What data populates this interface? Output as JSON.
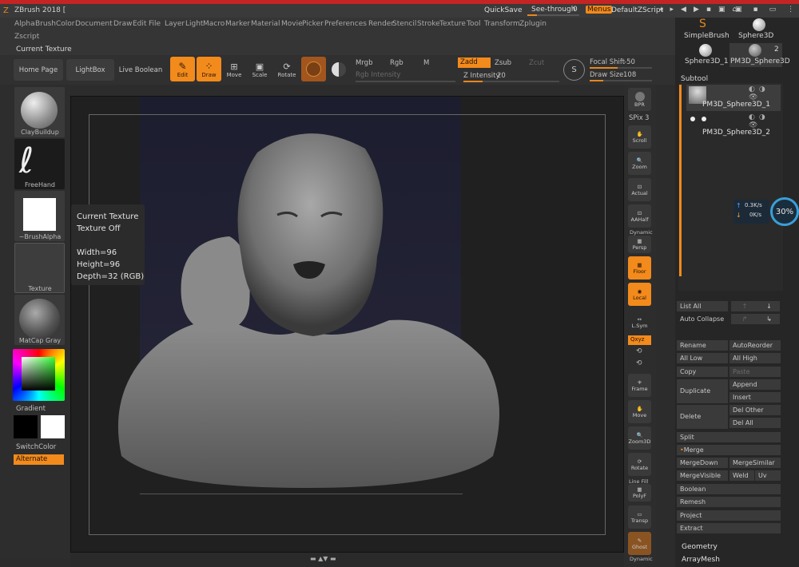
{
  "app": {
    "title": "ZBrush 2018 [",
    "quicksave": "QuickSave",
    "seethrough_label": "See-through",
    "seethrough_value": "0",
    "menus": "Menus",
    "script": "DefaultZScript"
  },
  "menu": [
    "Alpha",
    "Brush",
    "Color",
    "Document",
    "Draw",
    "Edit",
    "File",
    "Layer",
    "Light",
    "Macro",
    "Marker",
    "Material",
    "Movie",
    "Picker",
    "Preferences",
    "Render",
    "Stencil",
    "Stroke",
    "Texture",
    "Tool",
    "Transform",
    "Zplugin"
  ],
  "menu2": [
    "Zscript"
  ],
  "current_texture_label": "Current Texture",
  "toolbar": {
    "home": "Home Page",
    "lightbox": "LightBox",
    "liveboolean": "Live Boolean",
    "edit": "Edit",
    "draw": "Draw",
    "move": "Move",
    "scale": "Scale",
    "rotate": "Rotate",
    "mrgb": "Mrgb",
    "rgb": "Rgb",
    "m": "M",
    "zadd": "Zadd",
    "zsub": "Zsub",
    "zcut": "Zcut",
    "rgb_intensity": "Rgb Intensity",
    "z_intensity_label": "Z Intensity",
    "z_intensity": "20",
    "focal_label": "Focal Shift",
    "focal": "-50",
    "drawsize_label": "Draw Size",
    "drawsize": "108",
    "z_intensity_fraction": 0.2,
    "drawsize_fraction": 0.22,
    "focal_fraction": 0.45
  },
  "left": {
    "brush": "ClayBuildup",
    "stroke": "FreeHand",
    "alpha": "~BrushAlpha",
    "texture": "Texture",
    "material": "MatCap Gray",
    "gradient": "Gradient",
    "switchcolor": "SwitchColor",
    "alternate": "Alternate"
  },
  "tooltip": {
    "title": "Current Texture",
    "state": "Texture Off",
    "width": "Width=96",
    "height": "Height=96",
    "depth": "Depth=32 (RGB)"
  },
  "shelf": {
    "bpr": "BPR",
    "spix_label": "SPix",
    "spix": "3",
    "scroll": "Scroll",
    "zoom": "Zoom",
    "actual": "Actual",
    "aahalf": "AAHalf",
    "dynamic": "Dynamic",
    "persp": "Persp",
    "floor": "Floor",
    "local": "Local",
    "lsym": "L.Sym",
    "xyz": "Qxyz",
    "frame": "Frame",
    "move": "Move",
    "zoom3d": "Zoom3D",
    "rotate": "Rotate",
    "linefill": "Line Fill",
    "polyf": "PolyF",
    "transp": "Transp",
    "ghost": "Ghost",
    "dynamic2": "Dynamic"
  },
  "tools": {
    "simple": "SimpleBrush",
    "sphere": "Sphere3D",
    "sphere1": "Sphere3D_1",
    "pm3d": "PM3D_Sphere3D",
    "pm3d_count": "2"
  },
  "subtool": {
    "title": "Subtool",
    "item1": "PM3D_Sphere3D_1",
    "item2": "PM3D_Sphere3D_2"
  },
  "net": {
    "up": "0.3K/s",
    "down": "0K/s",
    "cpu": "30%"
  },
  "subtool_buttons": {
    "listall": "List All",
    "autocollapse": "Auto Collapse",
    "rename": "Rename",
    "autoreorder": "AutoReorder",
    "alllow": "All Low",
    "allhigh": "All High",
    "copy": "Copy",
    "paste": "Paste",
    "duplicate": "Duplicate",
    "append": "Append",
    "insert": "Insert",
    "delete": "Delete",
    "delother": "Del Other",
    "delall": "Del All",
    "split": "Split",
    "merge": "Merge",
    "mergedown": "MergeDown",
    "mergesimilar": "MergeSimilar",
    "mergevisible": "MergeVisible",
    "weld": "Weld",
    "uv": "Uv",
    "boolean": "Boolean",
    "remesh": "Remesh",
    "project": "Project",
    "extract": "Extract",
    "geometry": "Geometry",
    "arraymesh": "ArrayMesh"
  },
  "colors": {
    "accent": "#f28a1c",
    "panel": "#2d2d2d",
    "viewport": "#202020"
  }
}
